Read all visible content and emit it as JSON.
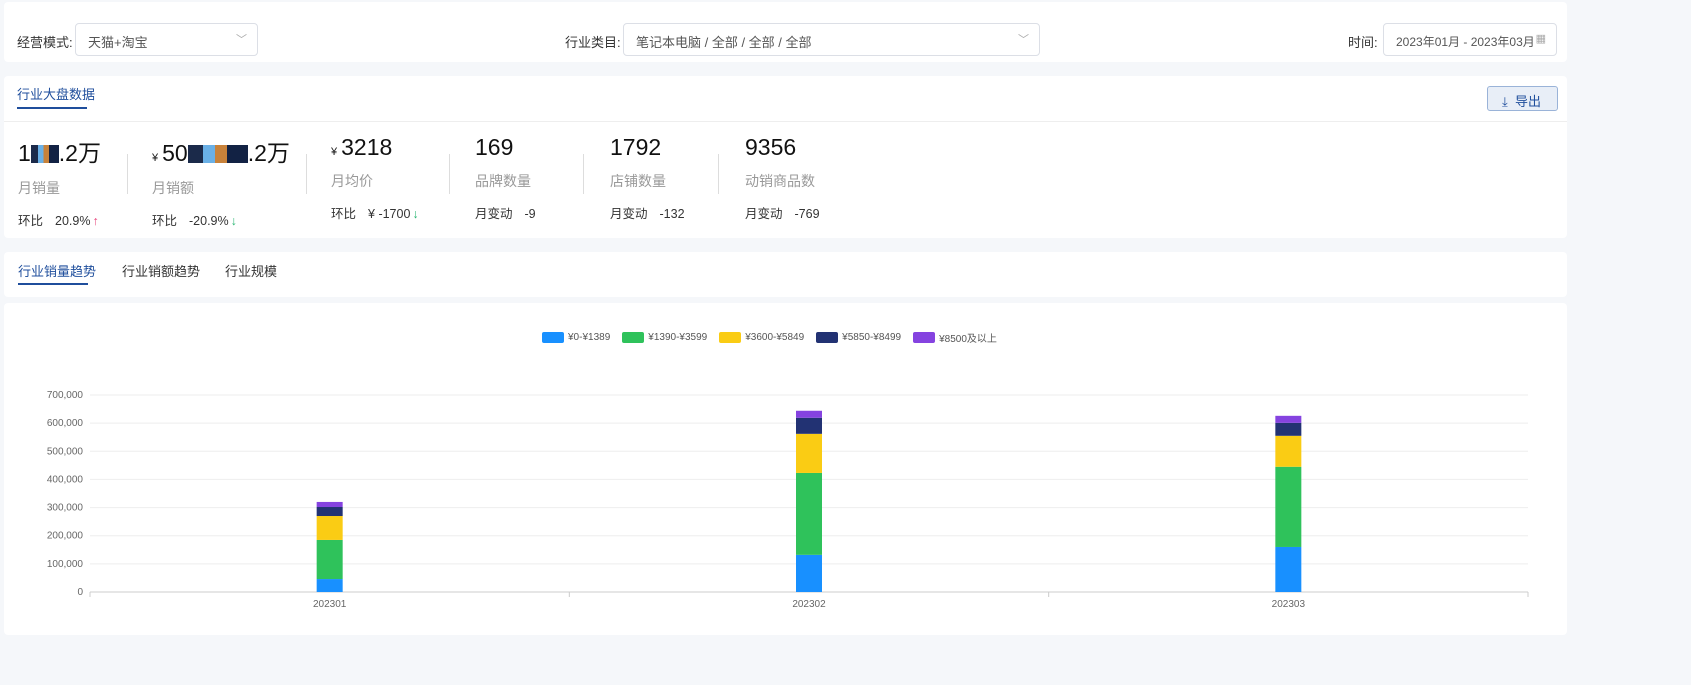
{
  "filters": {
    "mode_label": "经营模式:",
    "mode_value": "天猫+淘宝",
    "category_label": "行业类目:",
    "category_value": "笔记本电脑 / 全部 / 全部 / 全部",
    "time_label": "时间:",
    "time_value": "2023年01月 - 2023年03月"
  },
  "overview": {
    "tab": "行业大盘数据",
    "export_label": "导出",
    "stats": [
      {
        "prefix": "1",
        "suffix": ".2万",
        "label": "月销量",
        "change_label": "环比",
        "change": "20.9%",
        "arrow": "↑"
      },
      {
        "yen": "¥",
        "prefix": "50",
        "suffix": ".2万",
        "label": "月销额",
        "change_label": "环比",
        "change": "-20.9%",
        "arrow": "↓"
      },
      {
        "yen": "¥",
        "value": "3218",
        "label": "月均价",
        "change_label": "环比",
        "change": "¥ -1700",
        "arrow": "↓"
      },
      {
        "value": "169",
        "label": "品牌数量",
        "change_label": "月变动",
        "change": "-9"
      },
      {
        "value": "1792",
        "label": "店铺数量",
        "change_label": "月变动",
        "change": "-132"
      },
      {
        "value": "9356",
        "label": "动销商品数",
        "change_label": "月变动",
        "change": "-769"
      }
    ]
  },
  "trend_tabs": [
    "行业销量趋势",
    "行业销额趋势",
    "行业规模"
  ],
  "chart_data": {
    "type": "bar",
    "stacked": true,
    "categories": [
      "202301",
      "202302",
      "202303"
    ],
    "ylim": [
      0,
      700000
    ],
    "yticks": [
      "0",
      "100,000",
      "200,000",
      "300,000",
      "400,000",
      "500,000",
      "600,000",
      "700,000"
    ],
    "legend_position": "top-center",
    "series": [
      {
        "name": "¥0-¥1389",
        "color": "#1890ff",
        "values": [
          46000,
          132000,
          160000
        ]
      },
      {
        "name": "¥1390-¥3599",
        "color": "#2fc25b",
        "values": [
          139000,
          291000,
          285000
        ]
      },
      {
        "name": "¥3600-¥5849",
        "color": "#facc14",
        "values": [
          85000,
          139000,
          110000
        ]
      },
      {
        "name": "¥5850-¥8499",
        "color": "#223273",
        "values": [
          32000,
          57000,
          46000
        ]
      },
      {
        "name": "¥8500及以上",
        "color": "#8543e0",
        "values": [
          18000,
          25000,
          25000
        ]
      }
    ]
  }
}
